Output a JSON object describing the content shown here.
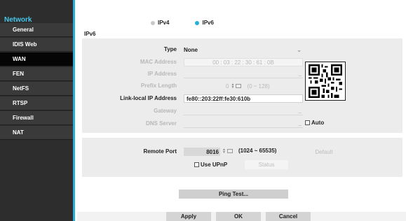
{
  "sidebar": {
    "title": "Network",
    "items": [
      {
        "label": "General"
      },
      {
        "label": "IDIS Web"
      },
      {
        "label": "WAN",
        "active": true
      },
      {
        "label": "FEN"
      },
      {
        "label": "NetFS"
      },
      {
        "label": "RTSP"
      },
      {
        "label": "Firewall"
      },
      {
        "label": "NAT"
      }
    ]
  },
  "ip_version": {
    "options": [
      "IPv4",
      "IPv6"
    ],
    "selected": "IPv6"
  },
  "section_title": "IPv6",
  "form": {
    "type_label": "Type",
    "type_value": "None",
    "mac_label": "MAC Address",
    "mac_value": "00 : 03 : 22 : 30 : 61 : 0B",
    "ip_label": "IP Address",
    "prefix_label": "Prefix Length",
    "prefix_value": "0",
    "prefix_range": "(0 ~ 128)",
    "linklocal_label": "Link-local IP Address",
    "linklocal_value": "fe80::203:22ff:fe30:610b",
    "gateway_label": "Gateway",
    "dns_label": "DNS Server",
    "auto_label": "Auto"
  },
  "port": {
    "remote_label": "Remote Port",
    "remote_value": "8016",
    "remote_range": "(1024 ~ 65535)",
    "default_label": "Default",
    "upnp_label": "Use UPnP",
    "status_label": "Status"
  },
  "buttons": {
    "ping": "Ping Test...",
    "apply": "Apply",
    "ok": "OK",
    "cancel": "Cancel"
  },
  "colors": {
    "accent": "#27b0d6",
    "sidebar_bg": "#2d2d2d",
    "active_bg": "#050505"
  }
}
